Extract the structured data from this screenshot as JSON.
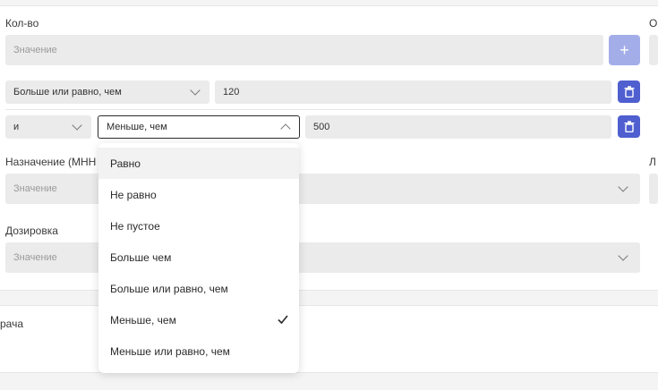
{
  "qty": {
    "label": "Кол-во",
    "placeholder": "Значение",
    "add_label": "+"
  },
  "condition1": {
    "operator": "Больше или равно, чем",
    "value": "120"
  },
  "condition2": {
    "logic": "и",
    "operator": "Меньше, чем",
    "value": "500"
  },
  "purpose": {
    "label": "Назначение (МНН",
    "placeholder": "Значение"
  },
  "dosage": {
    "label": "Дозировка",
    "placeholder": "Значение"
  },
  "right_cut": {
    "label1": "О",
    "label2": "Л"
  },
  "doctor_section": {
    "label": "рача"
  },
  "dropdown": {
    "options": [
      "Равно",
      "Не равно",
      "Не пустое",
      "Больше чем",
      "Больше или равно, чем",
      "Меньше, чем",
      "Меньше или равно, чем"
    ],
    "selected": "Меньше, чем",
    "hovered": "Равно"
  },
  "colors": {
    "accent": "#4f5fd0",
    "accent_disabled": "#a3aee9",
    "field_bg": "#ebebeb"
  }
}
